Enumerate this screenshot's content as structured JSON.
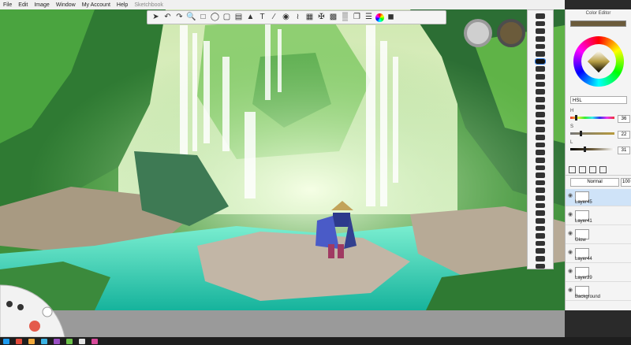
{
  "menu": {
    "items": [
      "File",
      "Edit",
      "Image",
      "Window",
      "My Account",
      "Help"
    ],
    "title_fragment": "Sketchbook"
  },
  "toolbar": {
    "icons": [
      "brush-icon",
      "undo-icon",
      "redo-icon",
      "zoom-icon",
      "select-icon",
      "lasso-icon",
      "crop-icon",
      "transform-icon",
      "distort-icon",
      "text-icon",
      "ruler-icon",
      "ellipse-icon",
      "french-curve-icon",
      "perspective-icon",
      "symmetry-icon",
      "fill-icon",
      "gradient-icon",
      "copy-icon",
      "layers-icon",
      "color-wheel-icon",
      "copic-icon"
    ]
  },
  "brushes": {
    "count": 34,
    "selected_index": 6
  },
  "color_editor": {
    "title": "Color Editor",
    "current_color": "#6b5b3b",
    "mode": "HSL",
    "h_label": "H",
    "s_label": "S",
    "l_label": "L",
    "h_value": "36",
    "s_value": "22",
    "l_value": "31",
    "h_fraction": 0.1,
    "s_fraction": 0.22,
    "l_fraction": 0.31
  },
  "layers": {
    "blend_mode": "Normal",
    "opacity": "100",
    "items": [
      {
        "name": "Layer45",
        "selected": true
      },
      {
        "name": "Layer41",
        "selected": false
      },
      {
        "name": "Glow",
        "selected": false
      },
      {
        "name": "Layer44",
        "selected": false
      },
      {
        "name": "Layer39",
        "selected": false
      },
      {
        "name": "Background",
        "selected": false
      }
    ]
  },
  "colors": {
    "accent": "#2c7be5",
    "swatch_primary": "#cfcfcf",
    "swatch_secondary": "#6b5b3b"
  }
}
